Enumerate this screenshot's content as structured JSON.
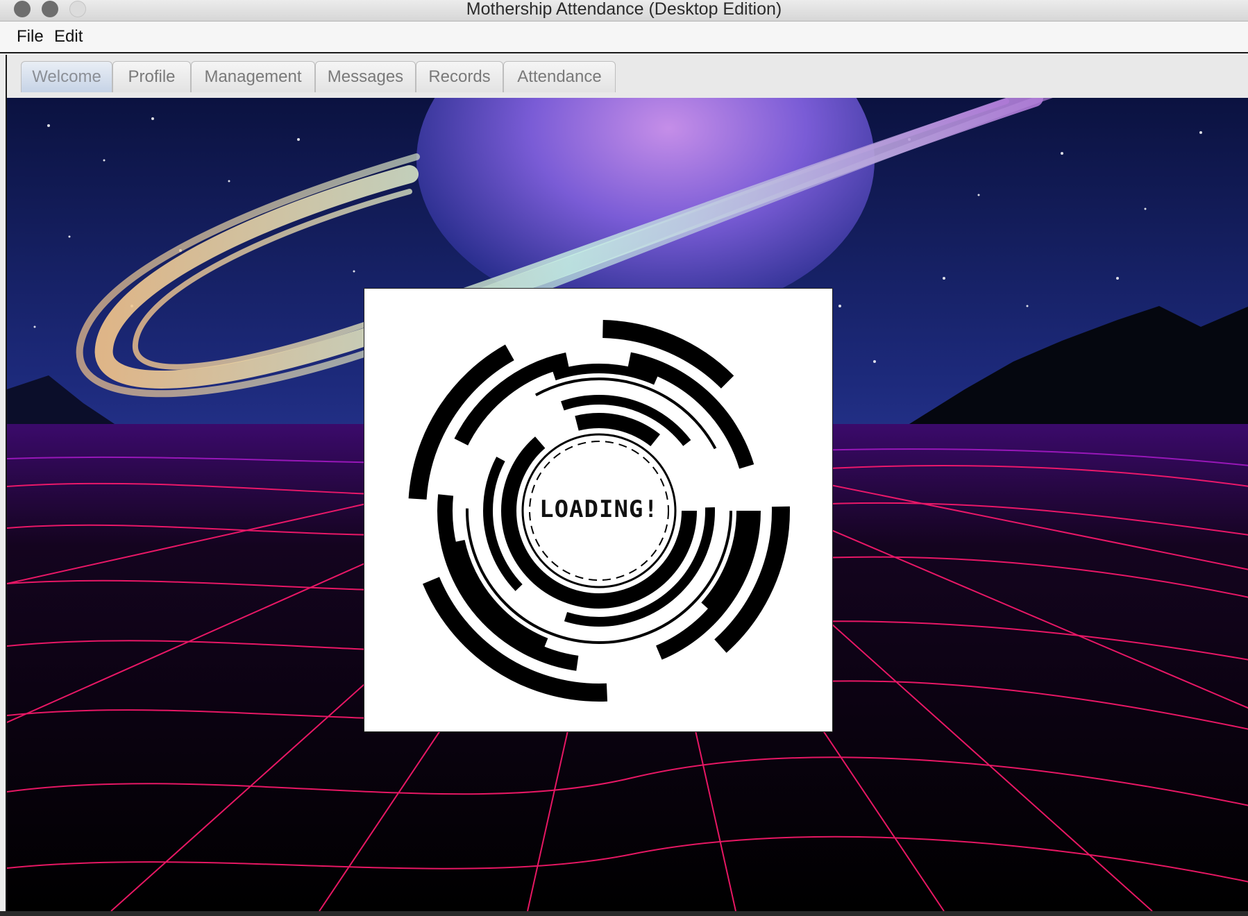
{
  "window": {
    "title": "Mothership Attendance (Desktop Edition)"
  },
  "menubar": {
    "items": [
      {
        "label": "File"
      },
      {
        "label": "Edit"
      }
    ]
  },
  "tabs": [
    {
      "label": "Welcome",
      "active": true
    },
    {
      "label": "Profile",
      "active": false
    },
    {
      "label": "Management",
      "active": false
    },
    {
      "label": "Messages",
      "active": false
    },
    {
      "label": "Records",
      "active": false
    },
    {
      "label": "Attendance",
      "active": false
    }
  ],
  "welcome": {
    "loading_text": "LOADING!",
    "background": "synthwave-space-planet-wireframe-grid"
  },
  "colors": {
    "sky_top": "#0b1240",
    "sky_mid": "#27348f",
    "grid": "#ff1a6e",
    "grid_far": "#b21bd1",
    "planet": "#7a5cd6"
  }
}
